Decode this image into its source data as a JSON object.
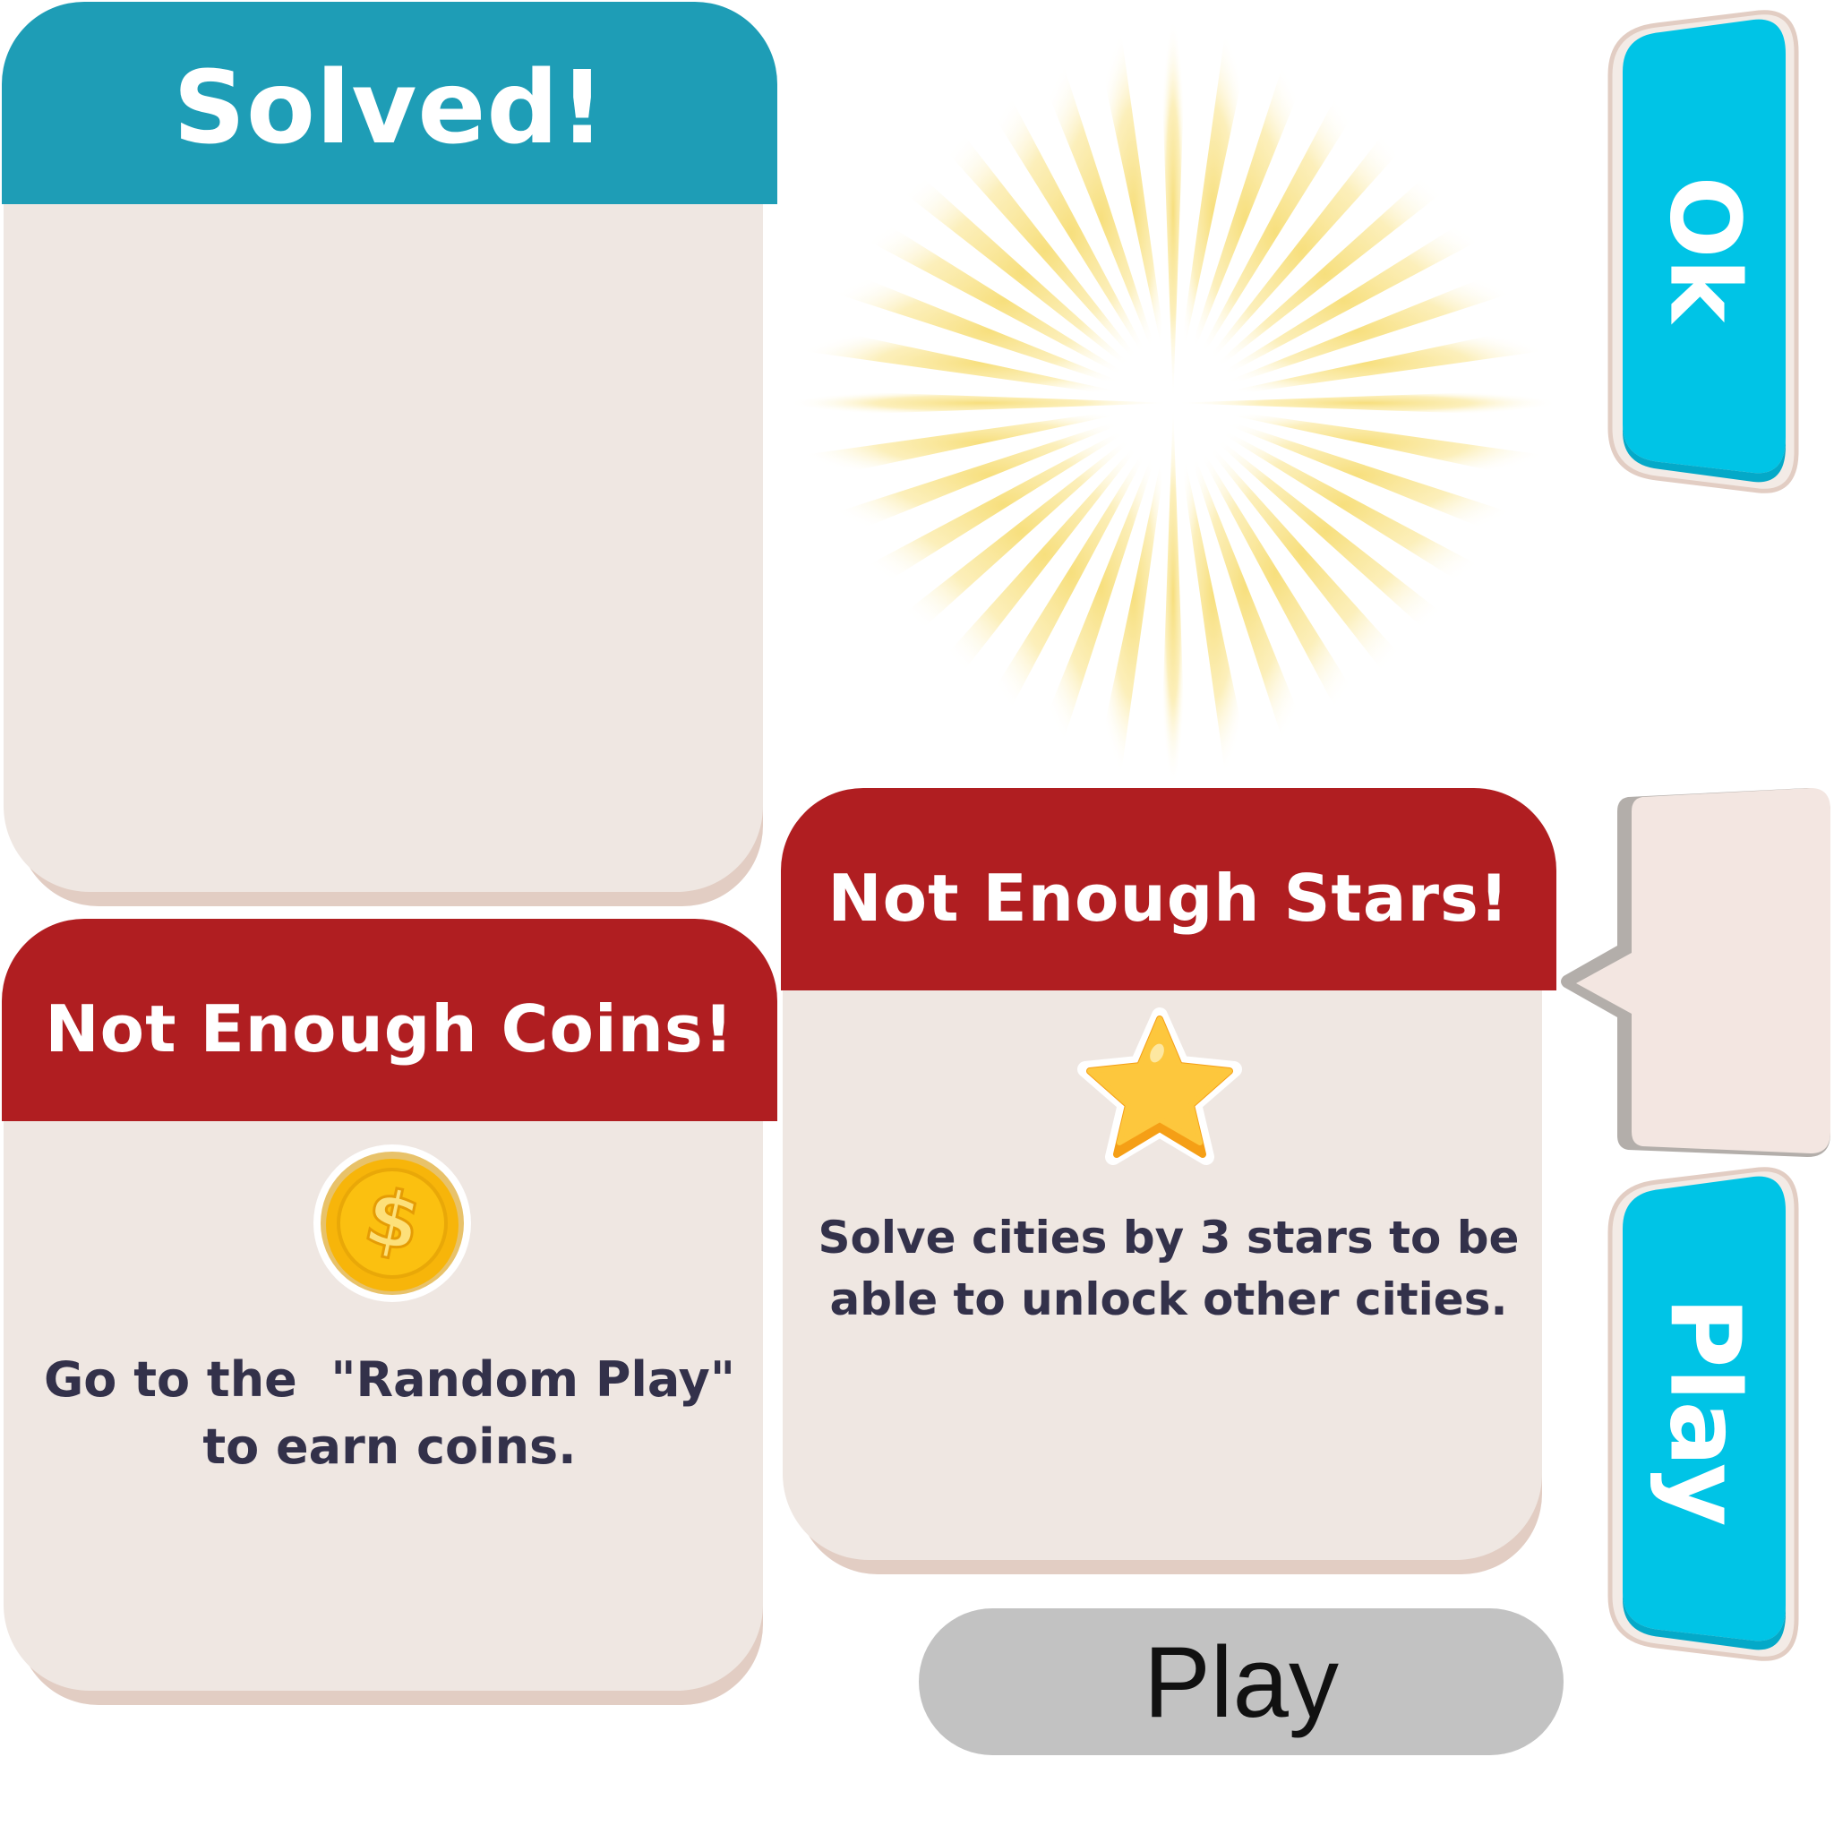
{
  "solved_panel": {
    "title": "Solved!",
    "header_color": "#1e9db6"
  },
  "coins_panel": {
    "title": "Not Enough Coins!",
    "header_color": "#b01e21",
    "message_line1": "Go to the  \"Random Play\"",
    "message_line2": "to earn coins.",
    "icon": "coin-icon",
    "coin_symbol": "$"
  },
  "stars_panel": {
    "title": "Not Enough Stars!",
    "header_color": "#b01e21",
    "message_line1": "Solve cities by 3 stars to be",
    "message_line2": "able to unlock other cities.",
    "icon": "star-icon"
  },
  "ok_button": {
    "label": "Ok",
    "color": "#00c4e6"
  },
  "play_button": {
    "label": "Play",
    "color": "#00c4e6"
  },
  "grey_play_button": {
    "label": "Play",
    "color": "#c2c2c2"
  },
  "tooltip": {
    "color": "#f3e6e1"
  },
  "sunburst": {
    "color": "#fbeaa0"
  }
}
